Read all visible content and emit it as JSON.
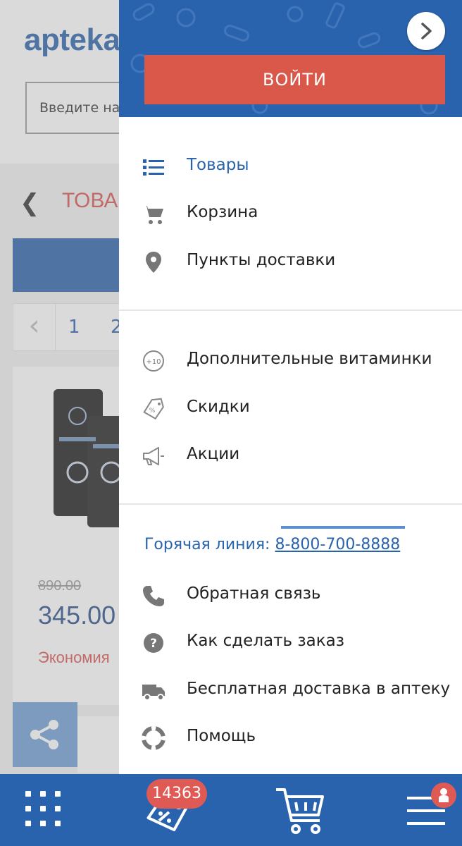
{
  "background": {
    "logo": "apteka",
    "search_placeholder": "Введите на",
    "section_title": "ТОВА",
    "pager": [
      "1",
      "2"
    ],
    "old_price": "890.00",
    "price": "345.00",
    "economy": "Экономия"
  },
  "drawer": {
    "login_label": "ВОЙТИ",
    "group1": [
      {
        "label": "Товары",
        "icon": "list-icon",
        "active": true
      },
      {
        "label": "Корзина",
        "icon": "cart-icon"
      },
      {
        "label": "Пункты доставки",
        "icon": "map-pin-icon"
      }
    ],
    "group2": [
      {
        "label": "Дополнительные витаминки",
        "icon": "plus-ten-icon"
      },
      {
        "label": "Скидки",
        "icon": "discount-tag-icon"
      },
      {
        "label": "Акции",
        "icon": "megaphone-icon"
      }
    ],
    "hotline": {
      "label": "Горячая линия:",
      "phone": "8-800-700-8888"
    },
    "group3": [
      {
        "label": "Обратная связь",
        "icon": "phone-icon"
      },
      {
        "label": "Как сделать заказ",
        "icon": "question-icon"
      },
      {
        "label": "Бесплатная доставка в аптеку",
        "icon": "truck-icon"
      },
      {
        "label": "Помощь",
        "icon": "lifebuoy-icon"
      }
    ]
  },
  "bottom_bar": {
    "discount_count": "14363",
    "items": [
      "grid-icon",
      "discount-tag-icon",
      "cart-icon",
      "menu-icon"
    ]
  },
  "colors": {
    "brand_blue": "#2a63ad",
    "login_red": "#d9584a",
    "badge_red": "#e05a55"
  }
}
